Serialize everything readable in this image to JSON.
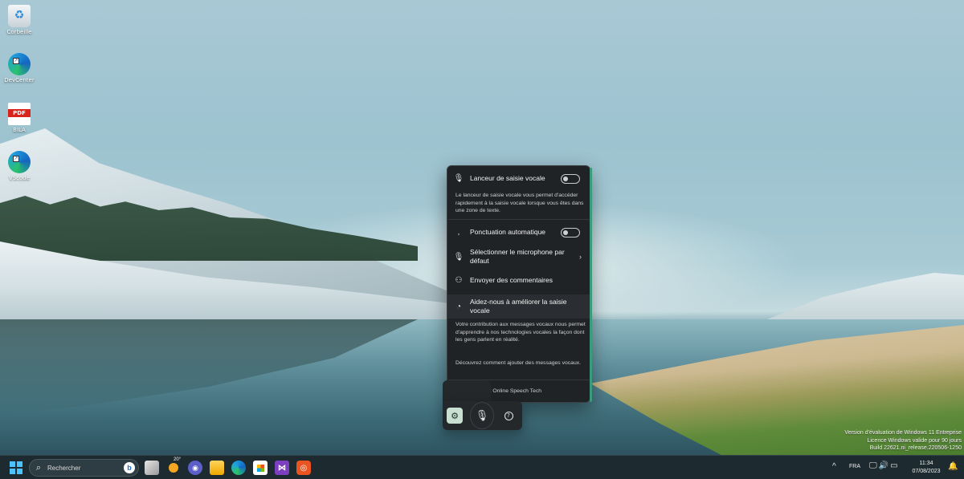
{
  "desktop": {
    "icons": [
      {
        "label": "Corbeille",
        "icon": "recycle-bin-icon"
      },
      {
        "label": "DevCenter",
        "icon": "edge-icon"
      },
      {
        "label": "BILA",
        "icon": "pdf-file-icon",
        "badge": "PDF"
      },
      {
        "label": "VScode",
        "icon": "edge-icon"
      }
    ]
  },
  "voice_panel": {
    "launcher": {
      "title": "Lanceur de saisie vocale",
      "enabled": false,
      "description": "Le lanceur de saisie vocale vous permet d'accéder rapidement à la saisie vocale lorsque vous êtes dans une zone de texte."
    },
    "punctuation": {
      "title": "Ponctuation automatique",
      "enabled": false
    },
    "microphone": {
      "title": "Sélectionner le microphone par défaut"
    },
    "feedback": {
      "title": "Envoyer des commentaires"
    },
    "improve": {
      "title": "Aidez-nous à améliorer la saisie vocale",
      "description": "Votre contribution aux messages vocaux nous permet d'apprendre à nos technologies vocales la façon dont les gens parlent en réalité.",
      "link": "Découvrez comment ajouter des messages vocaux."
    },
    "footer": "Avec Microsoft Online Speech Tech"
  },
  "voice_toolbar": {
    "settings_icon": "gear-icon",
    "mic_icon": "microphone-icon",
    "help_icon": "help-icon"
  },
  "watermark": {
    "line1": "Version d'évaluation de Windows 11 Entreprise",
    "line2": "Licence Windows valide pour 90 jours",
    "line3": "Build 22621.ni_release.220506-1250"
  },
  "taskbar": {
    "search_placeholder": "Rechercher",
    "weather_temp": "20°",
    "teams_glyph": "◉",
    "vs_glyph": "⋈",
    "ubuntu_glyph": "◎",
    "apps": [
      "task-view",
      "weather",
      "teams",
      "file-explorer",
      "edge",
      "store",
      "visual-studio",
      "ubuntu"
    ],
    "tray": {
      "language": "FRA",
      "time": "11:34",
      "date": "07/08/2023"
    }
  },
  "colors": {
    "accent": "#4cc2ff",
    "panel_bg": "#202326",
    "selected_button": "#c9dfd2"
  }
}
